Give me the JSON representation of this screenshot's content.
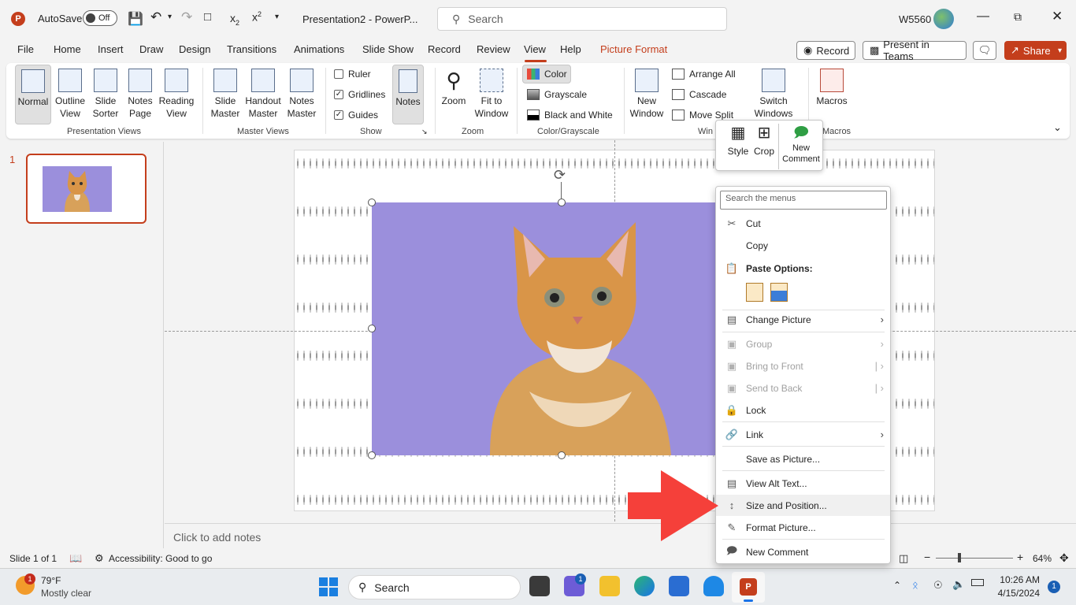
{
  "titlebar": {
    "autosave_label": "AutoSave",
    "autosave_state": "Off",
    "doc_title": "Presentation2 - PowerP...",
    "search_placeholder": "Search",
    "user": "W5560"
  },
  "tabs": [
    "File",
    "Home",
    "Insert",
    "Draw",
    "Design",
    "Transitions",
    "Animations",
    "Slide Show",
    "Record",
    "Review",
    "View",
    "Help",
    "Picture Format"
  ],
  "header_buttons": {
    "record": "Record",
    "present": "Present in Teams",
    "share": "Share"
  },
  "ribbon": {
    "presentation_views": {
      "label": "Presentation Views",
      "items": [
        "Normal",
        "Outline\nView",
        "Slide\nSorter",
        "Notes\nPage",
        "Reading\nView"
      ]
    },
    "master_views": {
      "label": "Master Views",
      "items": [
        "Slide\nMaster",
        "Handout\nMaster",
        "Notes\nMaster"
      ]
    },
    "show": {
      "label": "Show",
      "ruler": "Ruler",
      "gridlines": "Gridlines",
      "guides": "Guides",
      "notes": "Notes"
    },
    "zoom": {
      "label": "Zoom",
      "zoom": "Zoom",
      "fit": "Fit to\nWindow"
    },
    "color": {
      "label": "Color/Grayscale",
      "color": "Color",
      "grayscale": "Grayscale",
      "bw": "Black and White"
    },
    "window": {
      "label": "Win",
      "new_window": "New\nWindow",
      "arrange": "Arrange All",
      "cascade": "Cascade",
      "move_split": "Move Split",
      "switch": "Switch\nWindows"
    },
    "macros": {
      "label": "Macros",
      "macros": "Macros"
    }
  },
  "slide_panel": {
    "number": "1"
  },
  "notes_placeholder": "Click to add notes",
  "statusbar": {
    "slide": "Slide 1 of 1",
    "accessibility": "Accessibility: Good to go",
    "zoom": "64%"
  },
  "mini_toolbar": {
    "style": "Style",
    "crop": "Crop",
    "new_comment": "New\nComment"
  },
  "context_menu": {
    "search_placeholder": "Search the menus",
    "cut": "Cut",
    "copy": "Copy",
    "paste_options": "Paste Options:",
    "change_picture": "Change Picture",
    "group": "Group",
    "bring_front": "Bring to Front",
    "send_back": "Send to Back",
    "lock": "Lock",
    "link": "Link",
    "save_as_picture": "Save as Picture...",
    "view_alt": "View Alt Text...",
    "size_position": "Size and Position...",
    "format_picture": "Format Picture...",
    "new_comment": "New Comment"
  },
  "taskbar": {
    "weather_temp": "79°F",
    "weather_desc": "Mostly clear",
    "search": "Search",
    "time": "10:26 AM",
    "date": "4/15/2024",
    "weather_badge": "1",
    "teams_badge": "1",
    "notif": "1"
  },
  "colors": {
    "accent": "#c43e1c",
    "picture_bg": "#9b8fdc",
    "arrow": "#f5403a"
  }
}
